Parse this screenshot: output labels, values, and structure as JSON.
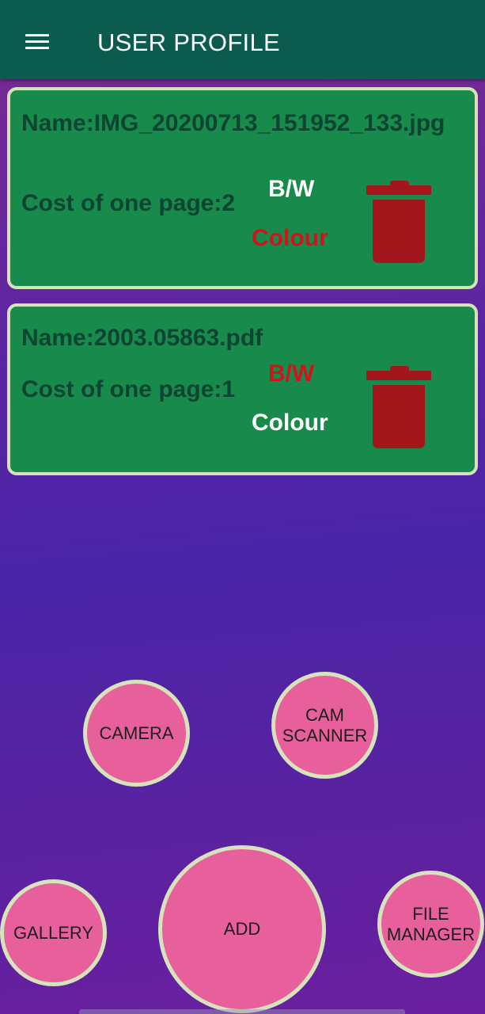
{
  "appbar": {
    "title": "USER PROFILE",
    "menu_icon": "hamburger-menu-icon",
    "color": "#0b5b4e"
  },
  "files": [
    {
      "name": "Name:IMG_20200713_151952_133.jpg",
      "cost": "Cost of one page:2",
      "bw_label": "B/W",
      "colour_label": "Colour",
      "selected": "Colour",
      "delete_icon": "trash-icon"
    },
    {
      "name": "Name:2003.05863.pdf",
      "cost": "Cost of one page:1",
      "bw_label": "B/W",
      "colour_label": "Colour",
      "selected": "B/W",
      "delete_icon": "trash-icon"
    }
  ],
  "actions": {
    "camera": "CAMERA",
    "cam_scanner": "CAM SCANNER",
    "gallery": "GALLERY",
    "add": "ADD",
    "file_manager": "FILE MANAGER"
  },
  "colors": {
    "card_bg": "#188a4b",
    "card_border": "#d5e4b8",
    "selected_option": "#d0141b",
    "unselected_option": "#ffffff",
    "trash": "#a3161c",
    "button_bg": "#e8609b"
  }
}
